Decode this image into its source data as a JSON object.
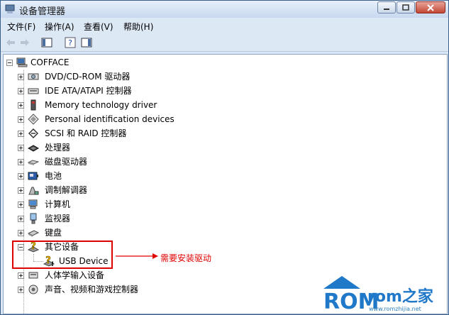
{
  "window": {
    "title": "设备管理器"
  },
  "menu": [
    {
      "label": "文件(F)"
    },
    {
      "label": "操作(A)"
    },
    {
      "label": "查看(V)"
    },
    {
      "label": "帮助(H)"
    }
  ],
  "tree": {
    "root": "COFFACE",
    "items": [
      {
        "label": "DVD/CD-ROM 驱动器",
        "icon": "dvd-drive-icon"
      },
      {
        "label": "IDE ATA/ATAPI 控制器",
        "icon": "ide-controller-icon"
      },
      {
        "label": "Memory technology driver",
        "icon": "memory-card-icon"
      },
      {
        "label": "Personal identification devices",
        "icon": "diamond-device-icon"
      },
      {
        "label": "SCSI 和 RAID 控制器",
        "icon": "scsi-controller-icon"
      },
      {
        "label": "处理器",
        "icon": "processor-icon"
      },
      {
        "label": "磁盘驱动器",
        "icon": "disk-drive-icon"
      },
      {
        "label": "电池",
        "icon": "battery-icon"
      },
      {
        "label": "调制解调器",
        "icon": "modem-icon"
      },
      {
        "label": "计算机",
        "icon": "computer-icon"
      },
      {
        "label": "监视器",
        "icon": "monitor-icon"
      },
      {
        "label": "键盘",
        "icon": "keyboard-icon"
      },
      {
        "label": "其它设备",
        "icon": "unknown-device-icon",
        "expanded": true
      },
      {
        "label": "人体学输入设备",
        "icon": "hid-icon"
      },
      {
        "label": "声音、视频和游戏控制器",
        "icon": "sound-icon"
      }
    ],
    "child": {
      "label": "USB Device",
      "icon": "warning-device-icon"
    }
  },
  "annotation": {
    "text": "需要安装驱动"
  },
  "watermark": {
    "brand": "ROM",
    "brand2": "rom之家",
    "url": "www.romzhijia.net"
  }
}
